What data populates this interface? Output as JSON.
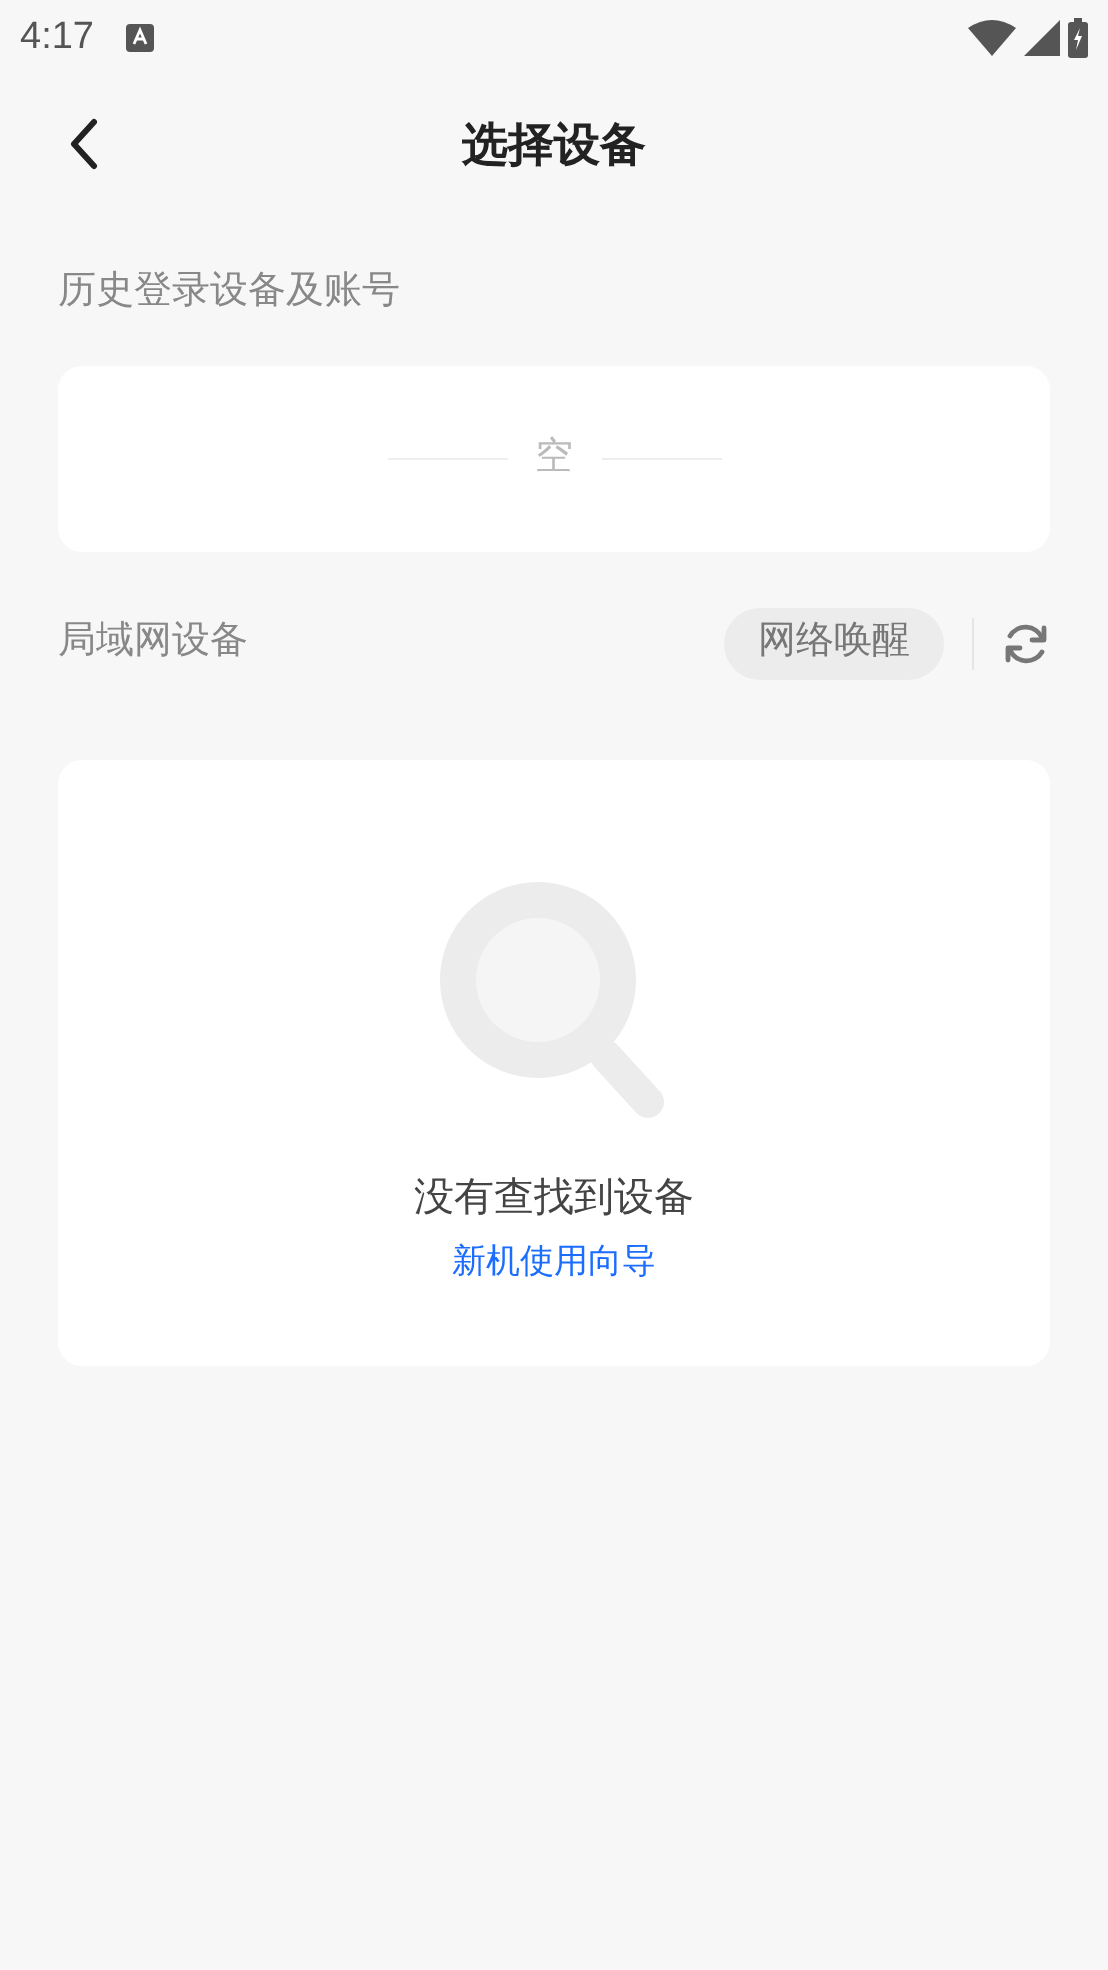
{
  "status_bar": {
    "time": "4:17"
  },
  "header": {
    "title": "选择设备"
  },
  "history": {
    "label": "历史登录设备及账号",
    "empty_text": "空"
  },
  "lan": {
    "label": "局域网设备",
    "wake_button": "网络唤醒",
    "empty_title": "没有查找到设备",
    "guide_link": "新机使用向导"
  }
}
